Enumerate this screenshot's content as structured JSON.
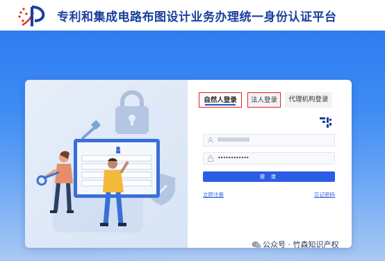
{
  "header": {
    "title": "专利和集成电路布图设计业务办理统一身份认证平台"
  },
  "login": {
    "tabs": [
      "自然人登录",
      "法人登录",
      "代理机构登录"
    ],
    "password_masked": "••••••••••••",
    "submit_label": "登 录",
    "register_label": "立即注册",
    "forgot_label": "忘记密码"
  },
  "watermark": {
    "text": "公众号 · 竹森知识产权"
  },
  "colors": {
    "brand": "#1a3f9c",
    "primary_button": "#2b5ce6",
    "highlight_box": "#e02020",
    "background_top": "#2e7cf0"
  },
  "icons": [
    "logo-emblem",
    "qr-code-icon",
    "user-icon",
    "lock-icon",
    "wechat-icon"
  ]
}
